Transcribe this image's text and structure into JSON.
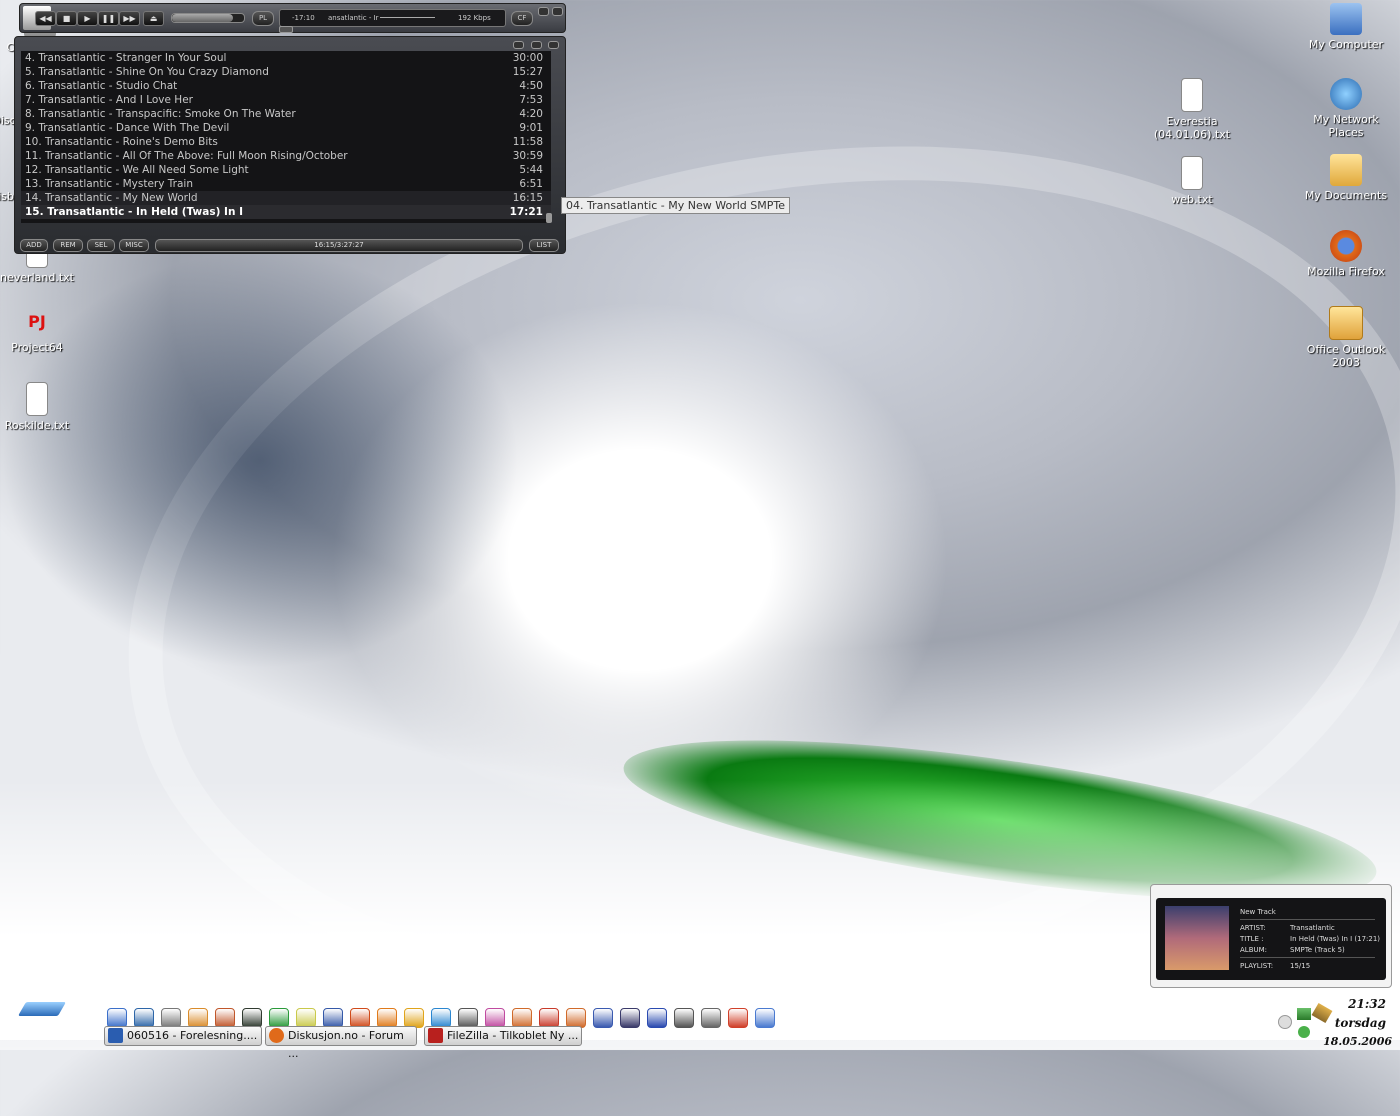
{
  "desktop_icons_left": [
    {
      "name": "connect-bat",
      "label": "Connect.bat"
    },
    {
      "name": "neverland-txt",
      "label": "neverland.txt"
    },
    {
      "name": "project64",
      "label": "Project64"
    },
    {
      "name": "roskilde-txt",
      "label": "Roskilde.txt"
    }
  ],
  "desktop_icons_left_partial": [
    "Disc",
    "isb"
  ],
  "desktop_icons_middle": [
    {
      "label": "Everestia (04.01.06).txt"
    },
    {
      "label": "web.txt"
    }
  ],
  "desktop_icons_right": [
    {
      "label": "My Computer"
    },
    {
      "label": "My Network Places"
    },
    {
      "label": "My Documents"
    },
    {
      "label": "Mozilla Firefox"
    },
    {
      "label": "Office Outlook 2003"
    }
  ],
  "player": {
    "time": "-17:10",
    "title_scroll": "ansatlantic - Ir",
    "bitrate": "192 Kbps",
    "pl_label": "PL",
    "cf_label": "CF",
    "volume": 0.85
  },
  "playlist": {
    "items": [
      {
        "title": "4. Transatlantic - Stranger In Your Soul",
        "duration": "30:00"
      },
      {
        "title": "5. Transatlantic - Shine On You Crazy Diamond",
        "duration": "15:27"
      },
      {
        "title": "6. Transatlantic - Studio Chat",
        "duration": "4:50"
      },
      {
        "title": "7. Transatlantic - And I Love Her",
        "duration": "7:53"
      },
      {
        "title": "8. Transatlantic - Transpacific: Smoke On The Water",
        "duration": "4:20"
      },
      {
        "title": "9. Transatlantic - Dance With The Devil",
        "duration": "9:01"
      },
      {
        "title": "10. Transatlantic - Roine's Demo Bits",
        "duration": "11:58"
      },
      {
        "title": "11. Transatlantic - All Of The Above: Full Moon Rising/October",
        "duration": "30:59"
      },
      {
        "title": "12. Transatlantic - We All Need Some Light",
        "duration": "5:44"
      },
      {
        "title": "13. Transatlantic - Mystery Train",
        "duration": "6:51"
      },
      {
        "title": "14. Transatlantic - My New World",
        "duration": "16:15"
      },
      {
        "title": "15. Transatlantic - In Held (Twas) In I",
        "duration": "17:21"
      }
    ],
    "buttons": {
      "add": "ADD",
      "rem": "REM",
      "sel": "SEL",
      "misc": "MISC",
      "list": "LIST"
    },
    "total_time": "16:15/3:27:27"
  },
  "tooltip": "04. Transatlantic - My New World SMPTe",
  "notification": {
    "heading": "New Track",
    "artist_label": "ARTIST:",
    "artist": "Transatlantic",
    "title_label": "TITLE :",
    "title": "In Held (Twas) In I (17:21)",
    "album_label": "ALBUM:",
    "album": "SMPTe (Track 5)",
    "playlist_label": "PLAYLIST:",
    "playlist": "15/15"
  },
  "tasks": [
    {
      "label": "060516 - Forelesning....",
      "icon_color": "#2a5db0"
    },
    {
      "label": "Diskusjon.no - Forum ...",
      "icon_color": "#e06a1a"
    },
    {
      "label": "FileZilla - Tilkoblet Ny ...",
      "icon_color": "#b8201e"
    }
  ],
  "clock": {
    "time": "21:32",
    "day": "torsdag",
    "date": "18.05.2006"
  },
  "quicklaunch_colors": [
    "#3b6fc9",
    "#2d66a8",
    "#777",
    "#d98b2a",
    "#c0562a",
    "#2f3a2f",
    "#2a9a3a",
    "#c9c94a",
    "#3458a8",
    "#d04a1a",
    "#e07a1a",
    "#e0a41a",
    "#2a86d0",
    "#555",
    "#c04aa0",
    "#d06a2a",
    "#c83a2a",
    "#d06a2a",
    "#3a5ab0",
    "#3a3a6a",
    "#2a4ab0",
    "#555",
    "#666",
    "#d0402a",
    "#4a7ad0"
  ]
}
